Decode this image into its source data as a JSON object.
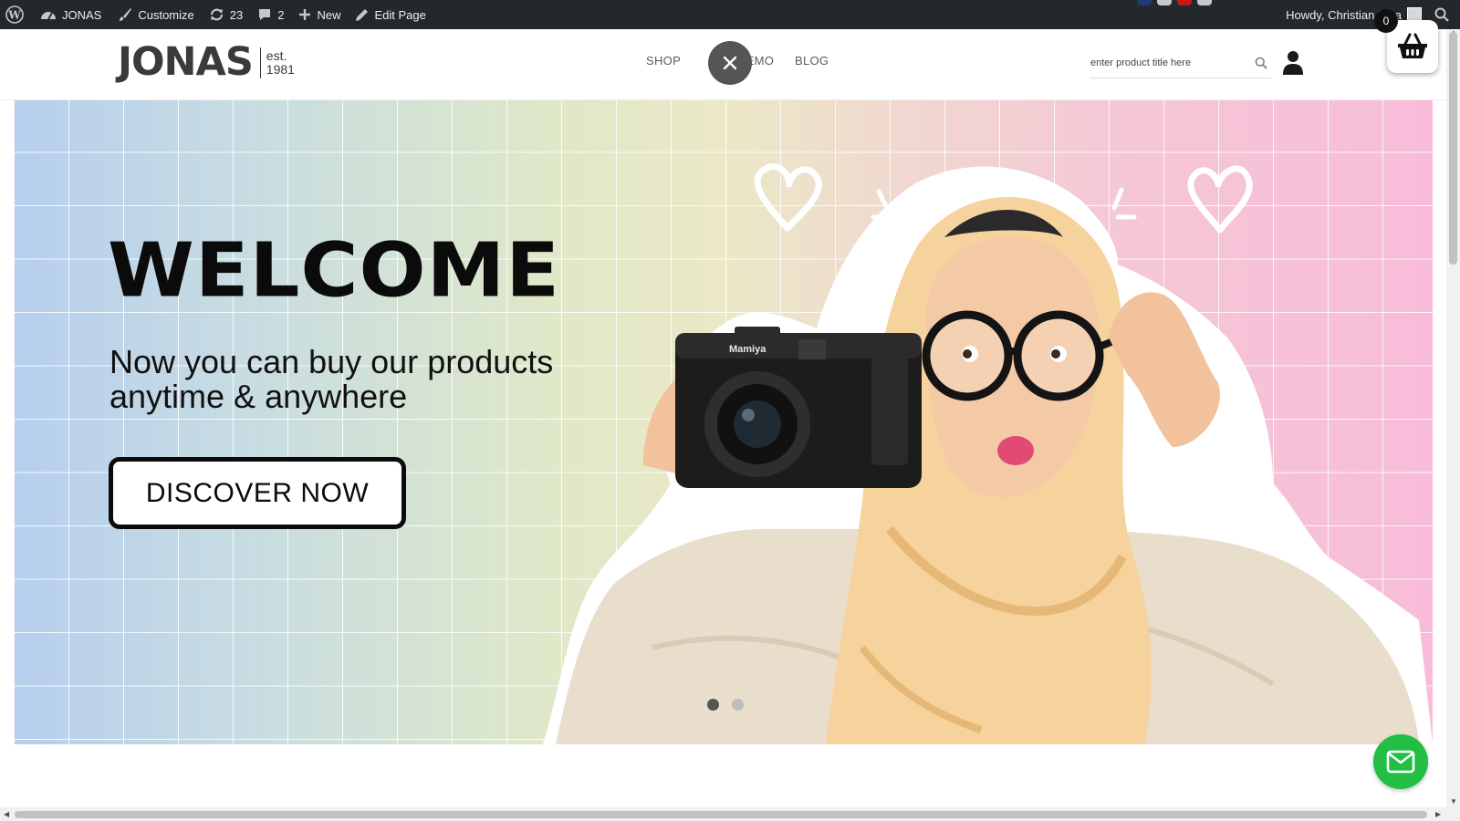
{
  "admin_bar": {
    "site_name": "JONAS",
    "customize": "Customize",
    "updates_count": "23",
    "comments_count": "2",
    "new_label": "New",
    "edit_page": "Edit Page",
    "howdy": "Howdy, Christian Riza"
  },
  "header": {
    "logo_text": "JONAS",
    "logo_est": "est.",
    "logo_year": "1981",
    "nav": {
      "shop": "SHOP",
      "demo": "DEMO",
      "blog": "BLOG"
    },
    "search_placeholder": "enter product title here",
    "cart_count": "0"
  },
  "hero": {
    "headline": "WELCOME",
    "subline_1": "Now you can buy our products",
    "subline_2": "anytime & anywhere",
    "cta": "DISCOVER NOW",
    "camera_brand": "Mamiya",
    "slides": [
      {
        "active": true
      },
      {
        "active": false
      }
    ]
  },
  "colors": {
    "admin_bar": "#23282d",
    "mail_button": "#22bf44",
    "text_dark": "#0b0b0b"
  }
}
